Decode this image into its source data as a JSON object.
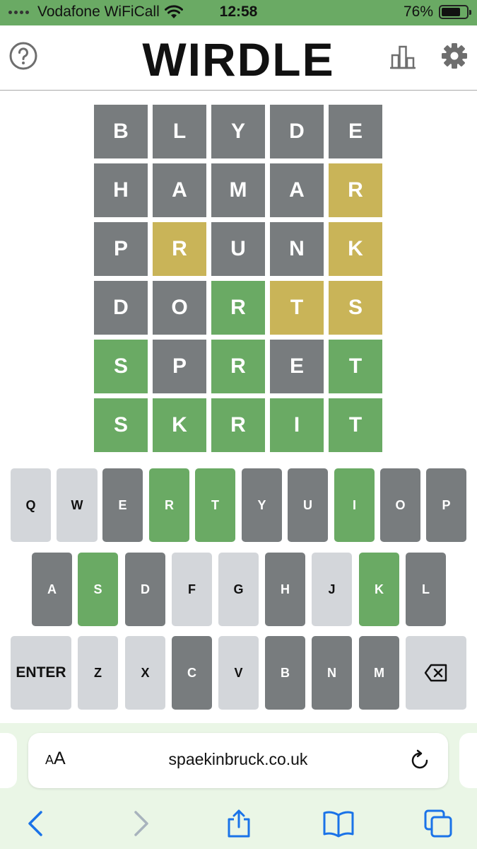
{
  "status_bar": {
    "carrier": "Vodafone WiFiCall",
    "time": "12:58",
    "battery": "76%",
    "battery_level": 0.76
  },
  "header": {
    "title": "WIRDLE",
    "icons": [
      "help-icon",
      "stats-icon",
      "settings-icon"
    ]
  },
  "board": {
    "rows": [
      [
        {
          "l": "B",
          "s": "absent"
        },
        {
          "l": "L",
          "s": "absent"
        },
        {
          "l": "Y",
          "s": "absent"
        },
        {
          "l": "D",
          "s": "absent"
        },
        {
          "l": "E",
          "s": "absent"
        }
      ],
      [
        {
          "l": "H",
          "s": "absent"
        },
        {
          "l": "A",
          "s": "absent"
        },
        {
          "l": "M",
          "s": "absent"
        },
        {
          "l": "A",
          "s": "absent"
        },
        {
          "l": "R",
          "s": "present"
        }
      ],
      [
        {
          "l": "P",
          "s": "absent"
        },
        {
          "l": "R",
          "s": "present"
        },
        {
          "l": "U",
          "s": "absent"
        },
        {
          "l": "N",
          "s": "absent"
        },
        {
          "l": "K",
          "s": "present"
        }
      ],
      [
        {
          "l": "D",
          "s": "absent"
        },
        {
          "l": "O",
          "s": "absent"
        },
        {
          "l": "R",
          "s": "correct"
        },
        {
          "l": "T",
          "s": "present"
        },
        {
          "l": "S",
          "s": "present"
        }
      ],
      [
        {
          "l": "S",
          "s": "correct"
        },
        {
          "l": "P",
          "s": "absent"
        },
        {
          "l": "R",
          "s": "correct"
        },
        {
          "l": "E",
          "s": "absent"
        },
        {
          "l": "T",
          "s": "correct"
        }
      ],
      [
        {
          "l": "S",
          "s": "correct"
        },
        {
          "l": "K",
          "s": "correct"
        },
        {
          "l": "R",
          "s": "correct"
        },
        {
          "l": "I",
          "s": "correct"
        },
        {
          "l": "T",
          "s": "correct"
        }
      ]
    ]
  },
  "keyboard": {
    "rows": [
      [
        {
          "k": "Q",
          "s": "unused"
        },
        {
          "k": "W",
          "s": "unused"
        },
        {
          "k": "E",
          "s": "absent"
        },
        {
          "k": "R",
          "s": "correct"
        },
        {
          "k": "T",
          "s": "correct"
        },
        {
          "k": "Y",
          "s": "absent"
        },
        {
          "k": "U",
          "s": "absent"
        },
        {
          "k": "I",
          "s": "correct"
        },
        {
          "k": "O",
          "s": "absent"
        },
        {
          "k": "P",
          "s": "absent"
        }
      ],
      [
        {
          "k": "A",
          "s": "absent"
        },
        {
          "k": "S",
          "s": "correct"
        },
        {
          "k": "D",
          "s": "absent"
        },
        {
          "k": "F",
          "s": "unused"
        },
        {
          "k": "G",
          "s": "unused"
        },
        {
          "k": "H",
          "s": "absent"
        },
        {
          "k": "J",
          "s": "unused"
        },
        {
          "k": "K",
          "s": "correct"
        },
        {
          "k": "L",
          "s": "absent"
        }
      ],
      [
        {
          "k": "ENTER",
          "s": "unused"
        },
        {
          "k": "Z",
          "s": "unused"
        },
        {
          "k": "X",
          "s": "unused"
        },
        {
          "k": "C",
          "s": "absent"
        },
        {
          "k": "V",
          "s": "unused"
        },
        {
          "k": "B",
          "s": "absent"
        },
        {
          "k": "N",
          "s": "absent"
        },
        {
          "k": "M",
          "s": "absent"
        },
        {
          "k": "",
          "s": "unused",
          "icon": "backspace-icon"
        }
      ]
    ]
  },
  "colors": {
    "absent": "#787c7e",
    "present": "#c9b458",
    "correct": "#6aaa64",
    "unused_key": "#d3d6da",
    "status_bar": "#6aaa64",
    "browser_tint": "#eaf6e6",
    "ios_blue": "#1a73e8"
  },
  "browser": {
    "text_size_small": "A",
    "text_size_big": "A",
    "url": "spaekinbruck.co.uk",
    "nav_icons": [
      "back-icon",
      "forward-icon",
      "share-icon",
      "bookmarks-icon",
      "tabs-icon"
    ]
  }
}
